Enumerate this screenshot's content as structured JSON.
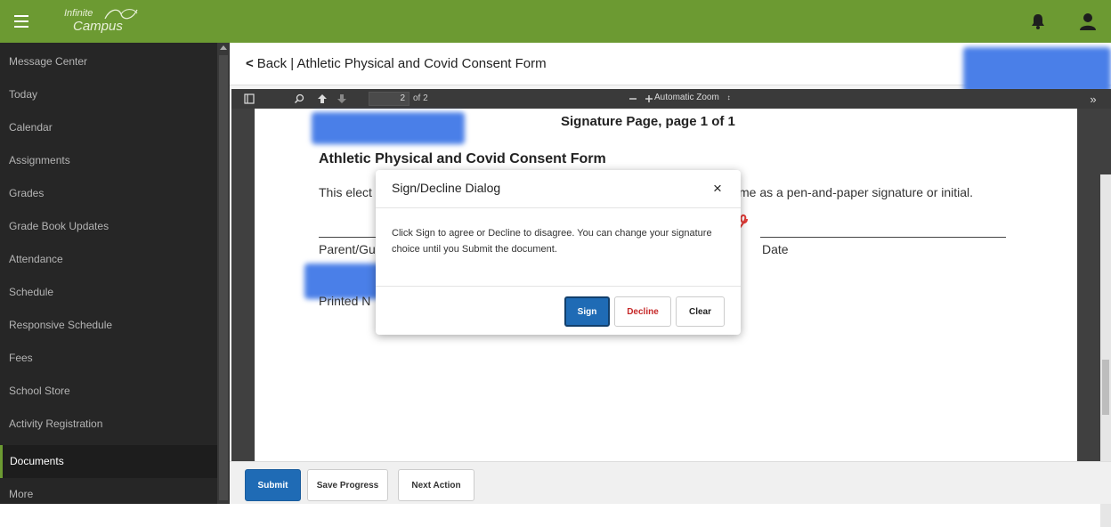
{
  "header": {
    "logo_line1": "Infinite",
    "logo_line2": "Campus",
    "brand_color": "#6c9a32"
  },
  "sidebar": {
    "items": [
      {
        "label": "Message Center"
      },
      {
        "label": "Today"
      },
      {
        "label": "Calendar"
      },
      {
        "label": "Assignments"
      },
      {
        "label": "Grades"
      },
      {
        "label": "Grade Book Updates"
      },
      {
        "label": "Attendance"
      },
      {
        "label": "Schedule"
      },
      {
        "label": "Responsive Schedule"
      },
      {
        "label": "Fees"
      },
      {
        "label": "School Store"
      },
      {
        "label": "Activity Registration"
      },
      {
        "label": "Documents",
        "active": true
      },
      {
        "label": "More"
      }
    ]
  },
  "page": {
    "back_label": "Back | Athletic Physical and Covid Consent Form"
  },
  "viewer": {
    "page_number": "2",
    "page_of": "of 2",
    "zoom_label": "Automatic Zoom"
  },
  "document": {
    "page_heading": "Signature Page, page 1 of 1",
    "form_title": "Athletic Physical and Covid Consent Form",
    "text_left": "This elect",
    "text_right": "me as a pen-and-paper signature or initial.",
    "sig_label_left": "Parent/Gu",
    "date_label": "Date",
    "printed_label": "Printed N"
  },
  "footer": {
    "submit_label": "Submit",
    "save_progress_label": "Save Progress",
    "next_action_label": "Next Action"
  },
  "dialog": {
    "title": "Sign/Decline Dialog",
    "close_symbol": "×",
    "body": "Click Sign to agree or Decline to disagree. You can change your signature choice until you Submit the document.",
    "sign_label": "Sign",
    "decline_label": "Decline",
    "clear_label": "Clear"
  }
}
